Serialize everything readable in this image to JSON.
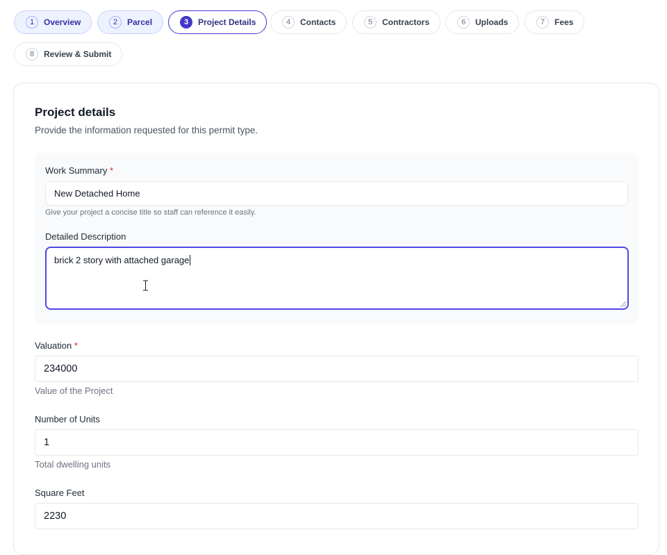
{
  "steps": [
    {
      "num": "1",
      "label": "Overview"
    },
    {
      "num": "2",
      "label": "Parcel"
    },
    {
      "num": "3",
      "label": "Project Details"
    },
    {
      "num": "4",
      "label": "Contacts"
    },
    {
      "num": "5",
      "label": "Contractors"
    },
    {
      "num": "6",
      "label": "Uploads"
    },
    {
      "num": "7",
      "label": "Fees"
    },
    {
      "num": "8",
      "label": "Review & Submit"
    }
  ],
  "active_step": "Project Details",
  "section": {
    "title": "Project details",
    "subtitle": "Provide the information requested for this permit type."
  },
  "work_summary": {
    "label": "Work Summary",
    "required_mark": "*",
    "value": "New Detached Home",
    "hint": "Give your project a concise title so staff can reference it easily."
  },
  "detailed_description": {
    "label": "Detailed Description",
    "value": "brick 2 story with attached garage"
  },
  "valuation": {
    "label": "Valuation",
    "required_mark": "*",
    "value": "234000",
    "hint": "Value of the Project"
  },
  "units": {
    "label": "Number of Units",
    "value": "1",
    "hint": "Total dwelling units"
  },
  "square_feet": {
    "label": "Square Feet",
    "value": "2230"
  },
  "colors": {
    "accent": "#4338ca",
    "required": "#dc2626",
    "completed_step_bg": "#eef2ff"
  }
}
